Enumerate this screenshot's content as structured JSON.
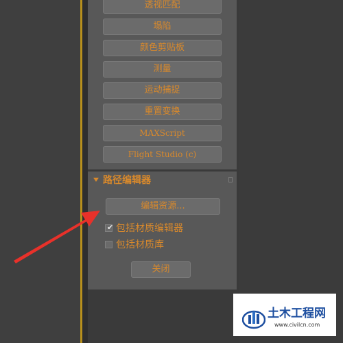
{
  "utilities_panel": {
    "buttons": [
      {
        "label": "透视匹配"
      },
      {
        "label": "塌陷"
      },
      {
        "label": "颜色剪贴板"
      },
      {
        "label": "测量"
      },
      {
        "label": "运动捕捉"
      },
      {
        "label": "重置变换"
      },
      {
        "label": "MAXScript"
      },
      {
        "label": "Flight Studio (c)"
      }
    ]
  },
  "path_editor_rollout": {
    "title": "路径编辑器",
    "edit_resources_label": "编辑资源...",
    "options": [
      {
        "label": "包括材质编辑器",
        "checked": true
      },
      {
        "label": "包括材质库",
        "checked": false
      }
    ],
    "close_label": "关闭"
  },
  "watermark": {
    "title": "土木工程网",
    "url": "www.civilcn.com"
  },
  "colors": {
    "text_accent": "#d8892c",
    "panel_bg": "#585858",
    "button_bg": "#6b6b6b",
    "viewport_border": "#b8901c",
    "annotation_arrow": "#e8312a"
  },
  "icons": {
    "rollout_toggle": "triangle-down-icon",
    "checkmark": "checkmark-icon",
    "annotation": "red-arrow-icon",
    "watermark_logo": "civilcn-logo"
  }
}
